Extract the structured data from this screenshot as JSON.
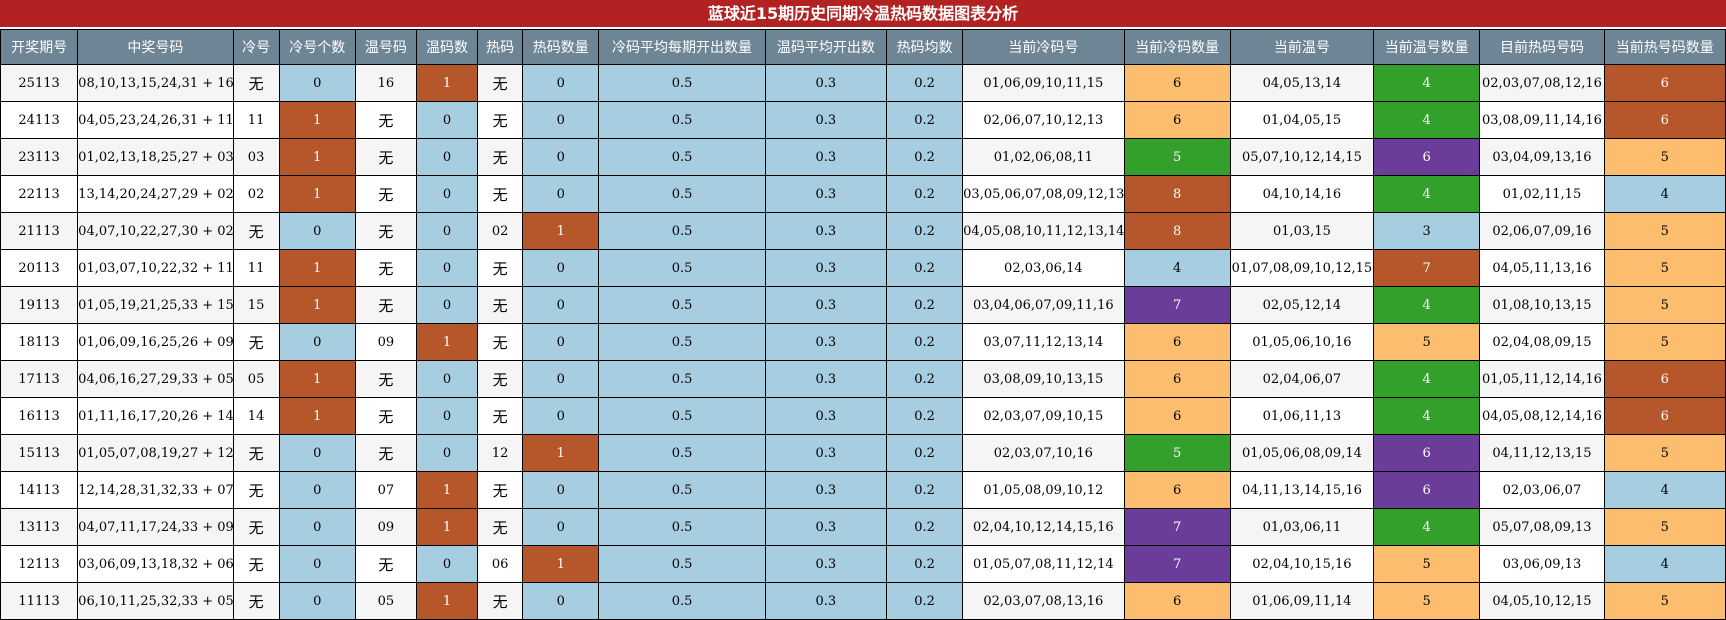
{
  "title": "蓝球近15期历史同期冷温热码数据图表分析",
  "colors": {
    "title_bar": "#b22222",
    "header": "#6e8596",
    "blue": "#a6cde0",
    "orange": "#b5572b",
    "peach": "#fdbd6e",
    "green": "#33a02c",
    "purple": "#6a3d9a"
  },
  "headers": [
    "开奖期号",
    "中奖号码",
    "冷号",
    "冷号个数",
    "温号码",
    "温码数",
    "热码",
    "热码数量",
    "冷码平均每期开出数量",
    "温码平均开出数",
    "热码均数",
    "当前冷码号",
    "当前冷码数量",
    "当前温号",
    "当前温号数量",
    "目前热码号码",
    "当前热号码数量"
  ],
  "rows": [
    {
      "cells": [
        "25113",
        "08,10,13,15,24,31 + 16",
        "无",
        "0",
        "16",
        "1",
        "无",
        "0",
        "0.5",
        "0.3",
        "0.2",
        "01,06,09,10,11,15",
        "6",
        "04,05,13,14",
        "4",
        "02,03,07,08,12,16",
        "6"
      ],
      "colors": [
        "",
        "",
        "",
        "blue",
        "",
        "orange",
        "",
        "blue",
        "blue",
        "blue",
        "blue",
        "",
        "peach",
        "",
        "green",
        "",
        "orange"
      ]
    },
    {
      "cells": [
        "24113",
        "04,05,23,24,26,31 + 11",
        "11",
        "1",
        "无",
        "0",
        "无",
        "0",
        "0.5",
        "0.3",
        "0.2",
        "02,06,07,10,12,13",
        "6",
        "01,04,05,15",
        "4",
        "03,08,09,11,14,16",
        "6"
      ],
      "colors": [
        "",
        "",
        "",
        "orange",
        "",
        "blue",
        "",
        "blue",
        "blue",
        "blue",
        "blue",
        "",
        "peach",
        "",
        "green",
        "",
        "orange"
      ]
    },
    {
      "cells": [
        "23113",
        "01,02,13,18,25,27 + 03",
        "03",
        "1",
        "无",
        "0",
        "无",
        "0",
        "0.5",
        "0.3",
        "0.2",
        "01,02,06,08,11",
        "5",
        "05,07,10,12,14,15",
        "6",
        "03,04,09,13,16",
        "5"
      ],
      "colors": [
        "",
        "",
        "",
        "orange",
        "",
        "blue",
        "",
        "blue",
        "blue",
        "blue",
        "blue",
        "",
        "green",
        "",
        "purple",
        "",
        "peach"
      ]
    },
    {
      "cells": [
        "22113",
        "13,14,20,24,27,29 + 02",
        "02",
        "1",
        "无",
        "0",
        "无",
        "0",
        "0.5",
        "0.3",
        "0.2",
        "03,05,06,07,08,09,12,13",
        "8",
        "04,10,14,16",
        "4",
        "01,02,11,15",
        "4"
      ],
      "colors": [
        "",
        "",
        "",
        "orange",
        "",
        "blue",
        "",
        "blue",
        "blue",
        "blue",
        "blue",
        "",
        "orange",
        "",
        "green",
        "",
        "blue"
      ]
    },
    {
      "cells": [
        "21113",
        "04,07,10,22,27,30 + 02",
        "无",
        "0",
        "无",
        "0",
        "02",
        "1",
        "0.5",
        "0.3",
        "0.2",
        "04,05,08,10,11,12,13,14",
        "8",
        "01,03,15",
        "3",
        "02,06,07,09,16",
        "5"
      ],
      "colors": [
        "",
        "",
        "",
        "blue",
        "",
        "blue",
        "",
        "orange",
        "blue",
        "blue",
        "blue",
        "",
        "orange",
        "",
        "blue",
        "",
        "peach"
      ]
    },
    {
      "cells": [
        "20113",
        "01,03,07,10,22,32 + 11",
        "11",
        "1",
        "无",
        "0",
        "无",
        "0",
        "0.5",
        "0.3",
        "0.2",
        "02,03,06,14",
        "4",
        "01,07,08,09,10,12,15",
        "7",
        "04,05,11,13,16",
        "5"
      ],
      "colors": [
        "",
        "",
        "",
        "orange",
        "",
        "blue",
        "",
        "blue",
        "blue",
        "blue",
        "blue",
        "",
        "blue",
        "",
        "orange",
        "",
        "peach"
      ]
    },
    {
      "cells": [
        "19113",
        "01,05,19,21,25,33 + 15",
        "15",
        "1",
        "无",
        "0",
        "无",
        "0",
        "0.5",
        "0.3",
        "0.2",
        "03,04,06,07,09,11,16",
        "7",
        "02,05,12,14",
        "4",
        "01,08,10,13,15",
        "5"
      ],
      "colors": [
        "",
        "",
        "",
        "orange",
        "",
        "blue",
        "",
        "blue",
        "blue",
        "blue",
        "blue",
        "",
        "purple",
        "",
        "green",
        "",
        "peach"
      ]
    },
    {
      "cells": [
        "18113",
        "01,06,09,16,25,26 + 09",
        "无",
        "0",
        "09",
        "1",
        "无",
        "0",
        "0.5",
        "0.3",
        "0.2",
        "03,07,11,12,13,14",
        "6",
        "01,05,06,10,16",
        "5",
        "02,04,08,09,15",
        "5"
      ],
      "colors": [
        "",
        "",
        "",
        "blue",
        "",
        "orange",
        "",
        "blue",
        "blue",
        "blue",
        "blue",
        "",
        "peach",
        "",
        "peach",
        "",
        "peach"
      ]
    },
    {
      "cells": [
        "17113",
        "04,06,16,27,29,33 + 05",
        "05",
        "1",
        "无",
        "0",
        "无",
        "0",
        "0.5",
        "0.3",
        "0.2",
        "03,08,09,10,13,15",
        "6",
        "02,04,06,07",
        "4",
        "01,05,11,12,14,16",
        "6"
      ],
      "colors": [
        "",
        "",
        "",
        "orange",
        "",
        "blue",
        "",
        "blue",
        "blue",
        "blue",
        "blue",
        "",
        "peach",
        "",
        "green",
        "",
        "orange"
      ]
    },
    {
      "cells": [
        "16113",
        "01,11,16,17,20,26 + 14",
        "14",
        "1",
        "无",
        "0",
        "无",
        "0",
        "0.5",
        "0.3",
        "0.2",
        "02,03,07,09,10,15",
        "6",
        "01,06,11,13",
        "4",
        "04,05,08,12,14,16",
        "6"
      ],
      "colors": [
        "",
        "",
        "",
        "orange",
        "",
        "blue",
        "",
        "blue",
        "blue",
        "blue",
        "blue",
        "",
        "peach",
        "",
        "green",
        "",
        "orange"
      ]
    },
    {
      "cells": [
        "15113",
        "01,05,07,08,19,27 + 12",
        "无",
        "0",
        "无",
        "0",
        "12",
        "1",
        "0.5",
        "0.3",
        "0.2",
        "02,03,07,10,16",
        "5",
        "01,05,06,08,09,14",
        "6",
        "04,11,12,13,15",
        "5"
      ],
      "colors": [
        "",
        "",
        "",
        "blue",
        "",
        "blue",
        "",
        "orange",
        "blue",
        "blue",
        "blue",
        "",
        "green",
        "",
        "purple",
        "",
        "peach"
      ]
    },
    {
      "cells": [
        "14113",
        "12,14,28,31,32,33 + 07",
        "无",
        "0",
        "07",
        "1",
        "无",
        "0",
        "0.5",
        "0.3",
        "0.2",
        "01,05,08,09,10,12",
        "6",
        "04,11,13,14,15,16",
        "6",
        "02,03,06,07",
        "4"
      ],
      "colors": [
        "",
        "",
        "",
        "blue",
        "",
        "orange",
        "",
        "blue",
        "blue",
        "blue",
        "blue",
        "",
        "peach",
        "",
        "purple",
        "",
        "blue"
      ]
    },
    {
      "cells": [
        "13113",
        "04,07,11,17,24,33 + 09",
        "无",
        "0",
        "09",
        "1",
        "无",
        "0",
        "0.5",
        "0.3",
        "0.2",
        "02,04,10,12,14,15,16",
        "7",
        "01,03,06,11",
        "4",
        "05,07,08,09,13",
        "5"
      ],
      "colors": [
        "",
        "",
        "",
        "blue",
        "",
        "orange",
        "",
        "blue",
        "blue",
        "blue",
        "blue",
        "",
        "purple",
        "",
        "green",
        "",
        "peach"
      ]
    },
    {
      "cells": [
        "12113",
        "03,06,09,13,18,32 + 06",
        "无",
        "0",
        "无",
        "0",
        "06",
        "1",
        "0.5",
        "0.3",
        "0.2",
        "01,05,07,08,11,12,14",
        "7",
        "02,04,10,15,16",
        "5",
        "03,06,09,13",
        "4"
      ],
      "colors": [
        "",
        "",
        "",
        "blue",
        "",
        "blue",
        "",
        "orange",
        "blue",
        "blue",
        "blue",
        "",
        "purple",
        "",
        "peach",
        "",
        "blue"
      ]
    },
    {
      "cells": [
        "11113",
        "06,10,11,25,32,33 + 05",
        "无",
        "0",
        "05",
        "1",
        "无",
        "0",
        "0.5",
        "0.3",
        "0.2",
        "02,03,07,08,13,16",
        "6",
        "01,06,09,11,14",
        "5",
        "04,05,10,12,15",
        "5"
      ],
      "colors": [
        "",
        "",
        "",
        "blue",
        "",
        "orange",
        "",
        "blue",
        "blue",
        "blue",
        "blue",
        "",
        "peach",
        "",
        "peach",
        "",
        "peach"
      ]
    }
  ]
}
